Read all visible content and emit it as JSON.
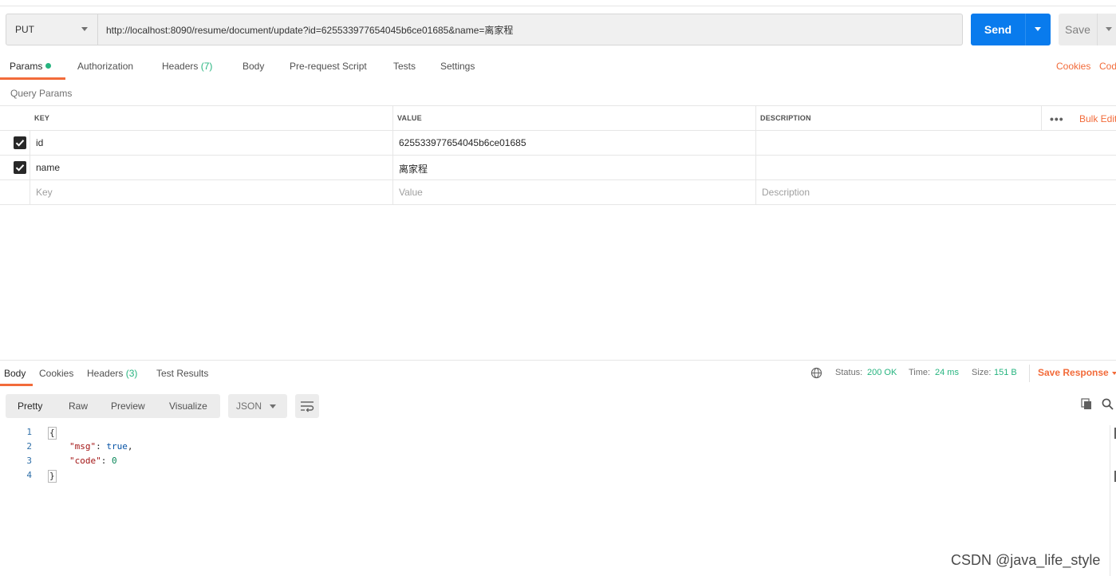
{
  "request": {
    "method": "PUT",
    "url": "http://localhost:8090/resume/document/update?id=625533977654045b6ce01685&name=离家程",
    "send_label": "Send",
    "save_label": "Save"
  },
  "request_tabs": {
    "params": "Params",
    "authorization": "Authorization",
    "headers": "Headers",
    "headers_count": "(7)",
    "body": "Body",
    "pre_request": "Pre-request Script",
    "tests": "Tests",
    "settings": "Settings",
    "cookies": "Cookies",
    "code": "Code"
  },
  "query_params": {
    "title": "Query Params",
    "columns": [
      "KEY",
      "VALUE",
      "DESCRIPTION"
    ],
    "bulk_edit": "Bulk Edit",
    "rows": [
      {
        "checked": true,
        "key": "id",
        "value": "625533977654045b6ce01685",
        "description": ""
      },
      {
        "checked": true,
        "key": "name",
        "value": "离家程",
        "description": ""
      }
    ],
    "placeholder": {
      "key": "Key",
      "value": "Value",
      "description": "Description"
    }
  },
  "response": {
    "tabs": {
      "body": "Body",
      "cookies": "Cookies",
      "headers": "Headers",
      "headers_count": "(3)",
      "test_results": "Test Results"
    },
    "status_label": "Status:",
    "status_value": "200 OK",
    "time_label": "Time:",
    "time_value": "24 ms",
    "size_label": "Size:",
    "size_value": "151 B",
    "save_response": "Save Response",
    "view_modes": [
      "Pretty",
      "Raw",
      "Preview",
      "Visualize"
    ],
    "format": "JSON",
    "body_lines": [
      {
        "n": "1",
        "text": "{"
      },
      {
        "n": "2",
        "key": "\"msg\"",
        "value": "true"
      },
      {
        "n": "3",
        "key": "\"code\"",
        "value": "0"
      },
      {
        "n": "4",
        "text": "}"
      }
    ]
  },
  "watermark": "CSDN @java_life_style",
  "colors": {
    "accent": "#f26b3a",
    "send": "#097bed",
    "success": "#26b47f"
  }
}
